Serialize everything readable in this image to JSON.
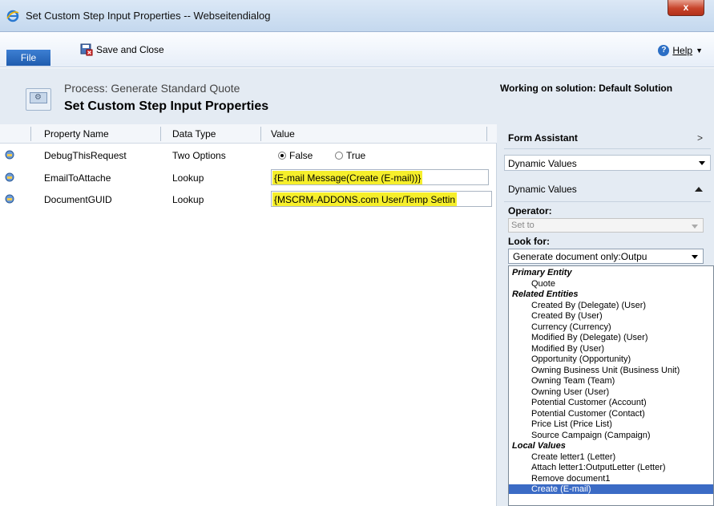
{
  "window": {
    "title": "Set Custom Step Input Properties -- Webseitendialog",
    "close_label": "x"
  },
  "ribbon": {
    "file_label": "File",
    "save_close_label": "Save and Close",
    "help_label": "Help"
  },
  "header": {
    "process_label": "Process: Generate Standard Quote",
    "title": "Set Custom Step Input Properties",
    "solution": "Working on solution: Default Solution"
  },
  "grid": {
    "columns": [
      "Property Name",
      "Data Type",
      "Value"
    ],
    "rows": [
      {
        "name": "DebugThisRequest",
        "type": "Two Options",
        "value_false": "False",
        "value_true": "True",
        "selected": "False"
      },
      {
        "name": "EmailToAttache",
        "type": "Lookup",
        "value": "{E-mail Message(Create (E-mail))}"
      },
      {
        "name": "DocumentGUID",
        "type": "Lookup",
        "value": "{MSCRM-ADDONS.com User/Temp Settin"
      }
    ]
  },
  "form_assistant": {
    "title": "Form Assistant",
    "collapse_glyph": ">",
    "dropdown_value": "Dynamic Values",
    "section_label": "Dynamic Values",
    "operator_label": "Operator:",
    "operator_value": "Set to",
    "look_for_label": "Look for:",
    "look_for_value": "Generate document only:Outpu"
  },
  "look_for_list": [
    {
      "label": "Primary Entity",
      "kind": "group"
    },
    {
      "label": "Quote",
      "kind": "opt"
    },
    {
      "label": "Related Entities",
      "kind": "group"
    },
    {
      "label": "Created By (Delegate) (User)",
      "kind": "opt"
    },
    {
      "label": "Created By (User)",
      "kind": "opt"
    },
    {
      "label": "Currency (Currency)",
      "kind": "opt"
    },
    {
      "label": "Modified By (Delegate) (User)",
      "kind": "opt"
    },
    {
      "label": "Modified By (User)",
      "kind": "opt"
    },
    {
      "label": "Opportunity (Opportunity)",
      "kind": "opt"
    },
    {
      "label": "Owning Business Unit (Business Unit)",
      "kind": "opt"
    },
    {
      "label": "Owning Team (Team)",
      "kind": "opt"
    },
    {
      "label": "Owning User (User)",
      "kind": "opt"
    },
    {
      "label": "Potential Customer (Account)",
      "kind": "opt"
    },
    {
      "label": "Potential Customer (Contact)",
      "kind": "opt"
    },
    {
      "label": "Price List (Price List)",
      "kind": "opt"
    },
    {
      "label": "Source Campaign (Campaign)",
      "kind": "opt"
    },
    {
      "label": "Local Values",
      "kind": "group"
    },
    {
      "label": "Create letter1 (Letter)",
      "kind": "opt"
    },
    {
      "label": "Attach letter1:OutputLetter (Letter)",
      "kind": "opt"
    },
    {
      "label": "Remove document1",
      "kind": "opt"
    },
    {
      "label": "Create (E-mail)",
      "kind": "opt",
      "selected": true
    }
  ]
}
